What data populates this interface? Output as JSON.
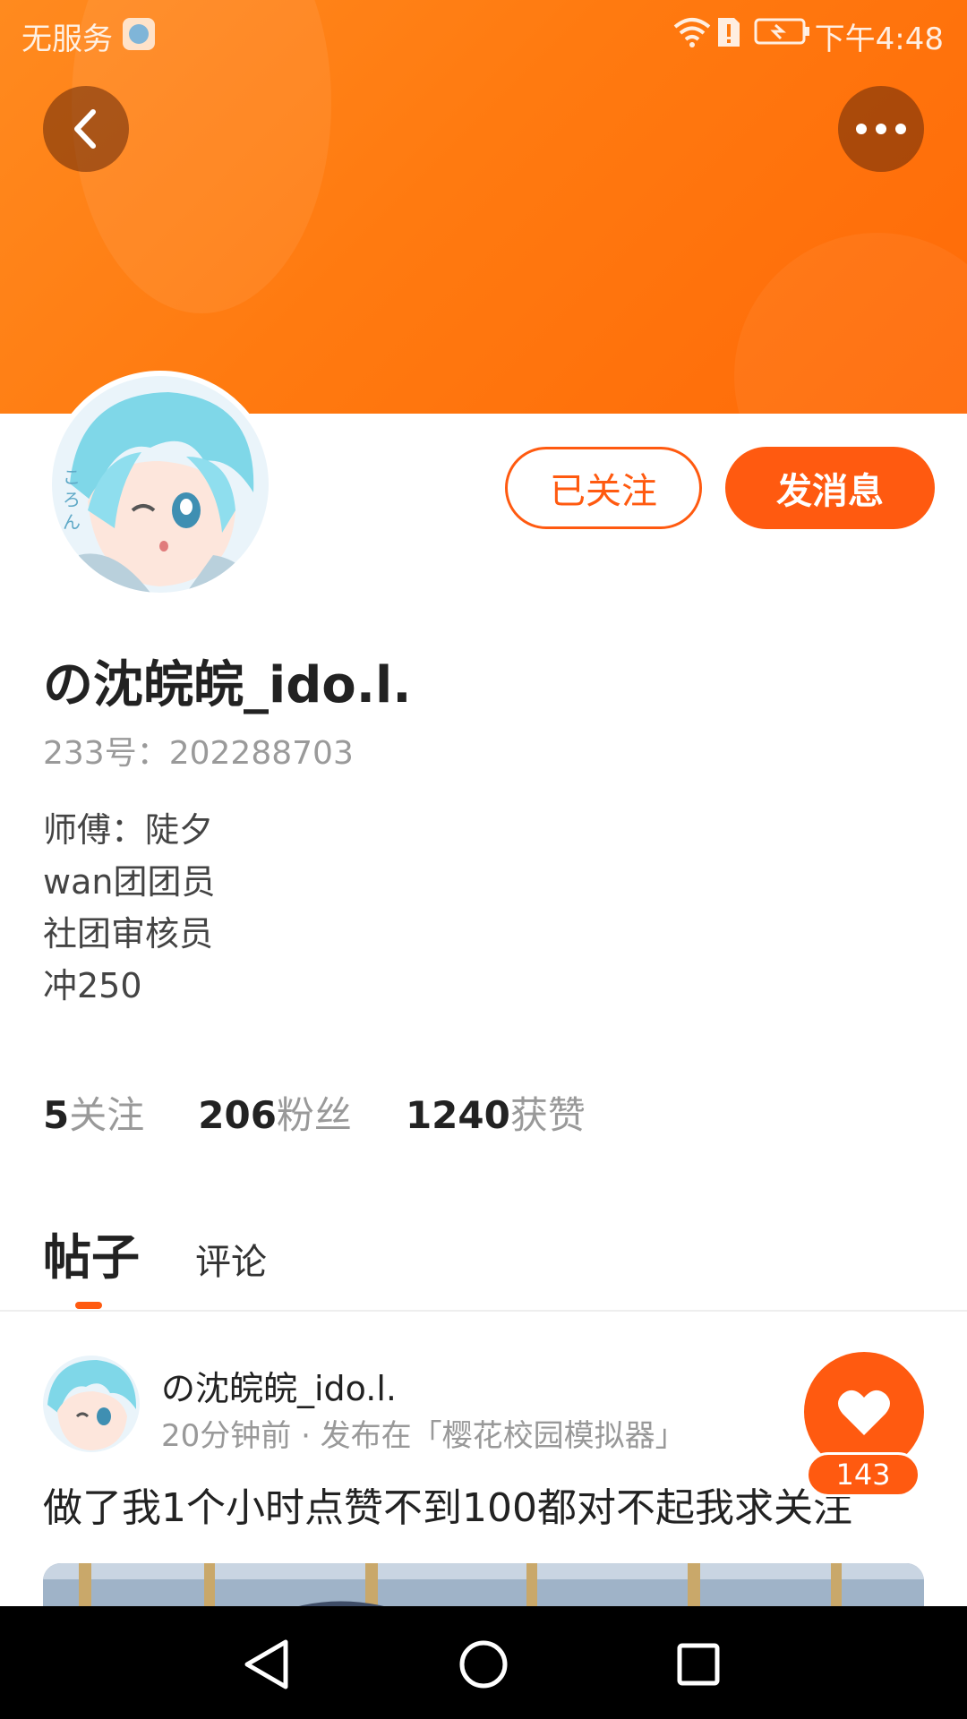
{
  "status_bar": {
    "carrier": "无服务",
    "time": "下午4:48"
  },
  "profile": {
    "follow_button": "已关注",
    "message_button": "发消息",
    "username": "の沈皖皖_ido.l.",
    "id_label": "233号：",
    "id_value": "202288703",
    "bio": [
      "师傅：陡夕",
      "wan团团员",
      "社团审核员",
      "冲250"
    ]
  },
  "stats": [
    {
      "num": "5",
      "label": "关注"
    },
    {
      "num": "206",
      "label": "粉丝"
    },
    {
      "num": "1240",
      "label": "获赞"
    }
  ],
  "tabs": {
    "posts": "帖子",
    "comments": "评论"
  },
  "post": {
    "author": "の沈皖皖_ido.l.",
    "meta": "20分钟前 · 发布在「樱花校园模拟器」",
    "text": "做了我1个小时点赞不到100都对不起我求关注",
    "likes": "143"
  },
  "colors": {
    "accent": "#ff5a10",
    "banner": "#ff7a10"
  },
  "icons": {
    "back": "chevron-left-icon",
    "more": "more-dots-icon",
    "like": "heart-icon",
    "nav_back": "triangle-back-icon",
    "nav_home": "circle-home-icon",
    "nav_recent": "square-recent-icon"
  }
}
